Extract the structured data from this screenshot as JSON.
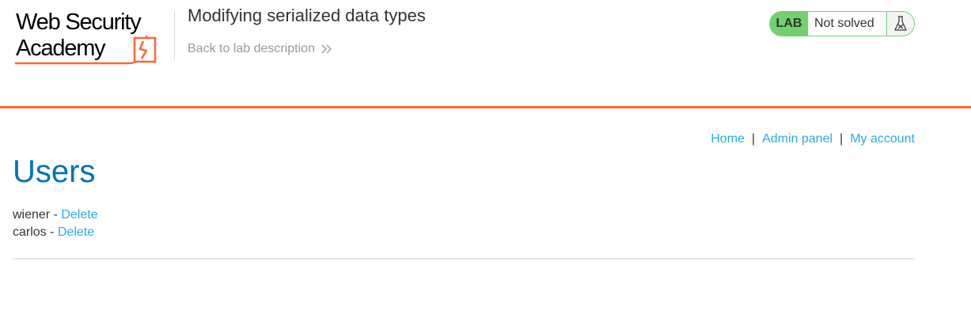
{
  "header": {
    "logo": {
      "line1": "Web Security",
      "line2": "Academy"
    },
    "lab_title": "Modifying serialized data types",
    "back_link": "Back to lab description",
    "lab_status": {
      "badge": "LAB",
      "status": "Not solved",
      "icon": "flask-icon"
    }
  },
  "nav": {
    "home": "Home",
    "separator": "|",
    "admin_panel": "Admin panel",
    "my_account": "My account"
  },
  "main": {
    "heading": "Users",
    "users": [
      {
        "name": "wiener",
        "separator": " - ",
        "action": "Delete"
      },
      {
        "name": "carlos",
        "separator": " - ",
        "action": "Delete"
      }
    ]
  },
  "colors": {
    "accent": "#ff6633",
    "link": "#29ace5",
    "heading": "#0071bc",
    "status_green": "#70d16d"
  }
}
